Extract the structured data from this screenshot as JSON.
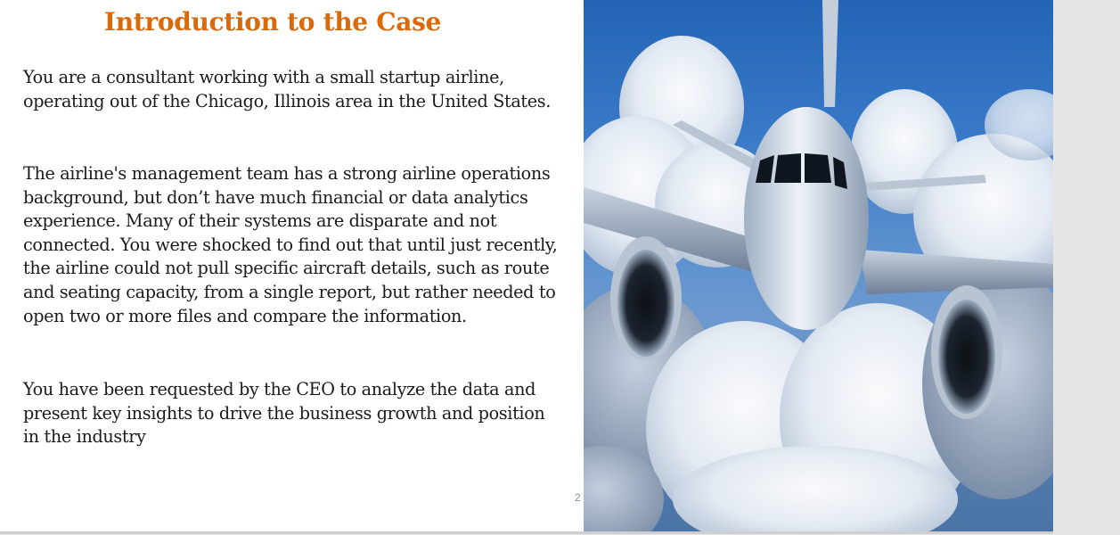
{
  "slide": {
    "title": "Introduction to the Case",
    "paragraphs": [
      "You are a consultant working with a small startup airline, operating out of the Chicago, Illinois area in the United States.",
      "The airline's management team has a strong airline operations background, but don’t have much financial or data analytics experience. Many of their systems are disparate and not connected. You were shocked to find out that until just recently, the airline could not pull specific aircraft details, such as route and seating capacity, from a single report, but rather needed to open two or more files and compare the information.",
      "You have been requested by the CEO to analyze the data and present key insights to drive the business growth and position in the industry"
    ],
    "page_number": "2",
    "image": {
      "icon": "airplane-in-clouds-photo"
    }
  },
  "colors": {
    "title": "#d9690b",
    "body_text": "#1a1a1a",
    "viewer_background": "#e6e6e6",
    "sky": "#3d7fcc"
  }
}
